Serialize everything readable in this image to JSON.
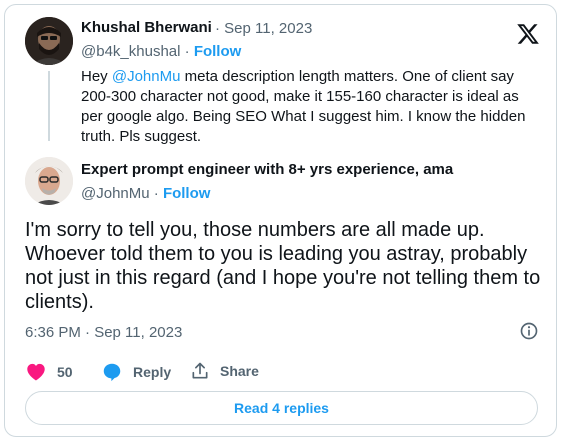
{
  "parent_tweet": {
    "author_name": "Khushal Bherwani",
    "separator": "·",
    "date": "Sep 11, 2023",
    "handle": "@b4k_khushal",
    "follow_label": "Follow",
    "text_pre": "Hey ",
    "mention": "@JohnMu",
    "text_post": " meta description length matters. One of client say 200-300 character not good, make it 155-160 character is ideal as per google algo. Being SEO What I suggest him.  I know the hidden truth. Pls suggest."
  },
  "reply_tweet": {
    "author_name": "Expert prompt engineer with 8+ yrs experience, ama",
    "handle": "@JohnMu",
    "separator": "·",
    "follow_label": "Follow",
    "text": "I'm sorry to tell you, those numbers are all made up. Whoever told them to you is leading you astray, probably not just in this regard (and I hope you're not telling them to clients).",
    "timestamp": "6:36 PM · Sep 11, 2023"
  },
  "actions": {
    "like_count": "50",
    "reply_label": "Reply",
    "share_label": "Share"
  },
  "read_replies_label": "Read 4 replies",
  "icons": {
    "brand": "x-logo-icon",
    "like": "heart-icon",
    "reply": "speech-bubble-icon",
    "share": "share-icon",
    "info": "info-icon"
  },
  "colors": {
    "accent": "#1d9bf0",
    "like": "#f91880",
    "text": "#0f1419",
    "muted": "#536471",
    "border": "#cfd9de"
  }
}
